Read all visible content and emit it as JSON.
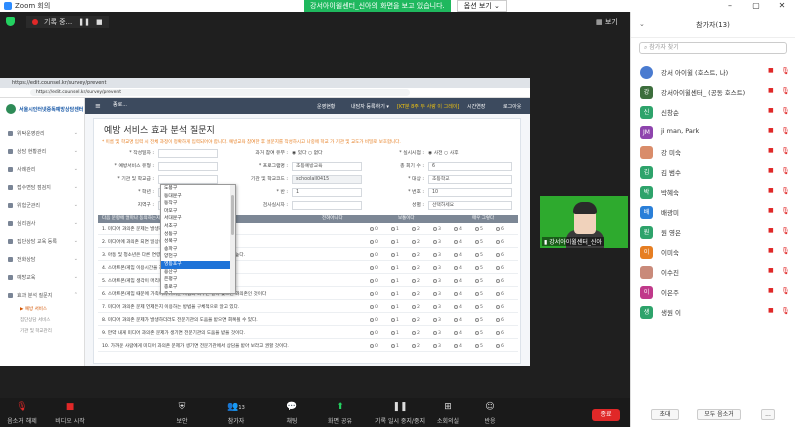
{
  "window": {
    "title": "Zoom 회의",
    "controls": [
      "–",
      "▢",
      "✕"
    ]
  },
  "share_banner": {
    "text": "강서아이윌센터_신아의 화면을 보고 있습니다.",
    "view_options": "옵션 보기 ⌄"
  },
  "recording": {
    "label": "기록 중...",
    "pause": "❚❚",
    "stop": "■"
  },
  "view_label": "보기",
  "browser": {
    "tab": "https://edit.counsel.kr/survey/prevent",
    "url": "https://edit.counsel.kr/survey/prevent"
  },
  "site": {
    "brand": "서울시인터넷중독예방상담센터",
    "nav": [
      {
        "label": "위탁운영관리"
      },
      {
        "label": "상담 현황관리"
      },
      {
        "label": "사례관리"
      },
      {
        "label": "접수면담 점검지"
      },
      {
        "label": "위험군관리"
      },
      {
        "label": "심리검사"
      },
      {
        "label": "집단상담 교육 등록"
      },
      {
        "label": "전화상담"
      },
      {
        "label": "예방교육"
      },
      {
        "label": "효과 분석 질문지"
      }
    ],
    "subnav": [
      {
        "label": "예방 서비스",
        "active": true
      },
      {
        "label": "집단상담 서비스",
        "active": false
      },
      {
        "label": "기관 및 학교관리",
        "active": false
      }
    ],
    "header": {
      "menu_icon": "≡",
      "combo": "종로...",
      "items": [
        "운영현황",
        "내담자 등록하기 ▾",
        "[KT분 8주 두 사랑 이 그레이]",
        "시간연장",
        "로그아웃"
      ]
    }
  },
  "form": {
    "title": "예방 서비스 효과 분석 질문지",
    "notice": "* 이름 및 학교명 입력 시 전체 과정이 정확하게 입력되어야 합니다. 예방교육 참여한 후 설문지를 작성하시고 나중에 학교 가 기관 및 교도가 비밀로 보호합니다.",
    "rows": [
      [
        {
          "label": "* 작성일자 :",
          "value": ""
        },
        {
          "label": "과거 참여 유무 :",
          "value": "◉ 있다   ○ 없다"
        },
        {
          "label": "* 실시시점 :",
          "value": "◉ 사전   ○ 사후"
        }
      ],
      [
        {
          "label": "* 예방서비스 유형 :",
          "value": ""
        },
        {
          "label": "* 프로그램명 :",
          "value": "초등예방교육"
        },
        {
          "label": "총 회기 수 :",
          "value": "6"
        }
      ],
      [
        {
          "label": "* 기관 및 학교급 :",
          "value": ""
        },
        {
          "label": "기관 및 학교코드 :",
          "value": "schoolall0415"
        },
        {
          "label": "* 대상 :",
          "value": "초등학교"
        }
      ],
      [
        {
          "label": "* 학년 :",
          "value": ""
        },
        {
          "label": "* 반 :",
          "value": "1"
        },
        {
          "label": "* 번호 :",
          "value": "10"
        }
      ],
      [
        {
          "label": "지역구 :",
          "value": "선택하세요"
        },
        {
          "label": "검사실시자 :",
          "value": ""
        },
        {
          "label": "성별 :",
          "value": "선택하세요"
        }
      ]
    ],
    "question_header": {
      "left": "다음 문항에 얼마나 동의하는지 체크해 주세요",
      "c1": "전혀아니다",
      "c2": "보통이다",
      "c3": "매우 그렇다"
    },
    "question_options": [
      "0",
      "1",
      "2",
      "3",
      "4",
      "5",
      "6"
    ],
    "questions": [
      "1. 미디어 과의존 문제는 발생하지 않도록 예방하는 것이 최선이다.",
      "2. 미디어에 과의존 되면 일상생활에 심각한 피해가 발생한다.",
      "3. 아동 및 청소년은 다른 연령대에 비해 미디어에 과의존될 위험성이 높다.",
      "4. 스마트폰/게임 이용시간을 지키는 것이 어려우면 과의존인 것이다.",
      "5. 스마트폰/게임 생각이 머리에서 떠나지 않으면 과의존인 것이다",
      "6. 스마트폰/게임 때문에 가족이나 가까운 사람과 다투는 일이 잦으면 과의존인 것이다",
      "7. 미디어 과의존 문제 언제든지 이용하는 방법을 구체적으로 알고 있다.",
      "8. 미디어 과의존 문제가 발생하더라도 전문기관의 도움을 받으면 회복될 수 있다.",
      "9. 만약 내게 미디어 과의존 문제가 생기면 전문기관의 도움을 받을 것이다.",
      "10. 가까운 사람에게 미디어 과의존 문제가 생기면 전문기관에서 상담을 받아 보라고 권할 것이다."
    ],
    "district_dropdown": {
      "options": [
        "도봉구",
        "동대문구",
        "동작구",
        "마포구",
        "서대문구",
        "서초구",
        "성동구",
        "성북구",
        "송파구",
        "양천구",
        "영등포구",
        "용산구",
        "은평구",
        "종로구",
        "중구",
        "중랑구"
      ],
      "selected": "영등포구"
    }
  },
  "self_video": {
    "caption": "강서아이윌센터_신아"
  },
  "toolbar": [
    {
      "label": "음소거 해제",
      "icon": "🎙"
    },
    {
      "label": "비디오 시작",
      "icon": "■"
    },
    {
      "label": "보안",
      "icon": "⛨"
    },
    {
      "label": "참가자",
      "icon": "👥",
      "count": "13"
    },
    {
      "label": "채팅",
      "icon": "💬"
    },
    {
      "label": "화면 공유",
      "icon": "⬆"
    },
    {
      "label": "기록 일시 중지/중지",
      "icon": "❚❚"
    },
    {
      "label": "소회의실",
      "icon": "⊞"
    },
    {
      "label": "반응",
      "icon": "☺"
    }
  ],
  "end_button": "종료",
  "participants": {
    "title": "참가자(13)",
    "search_placeholder": "참가자 찾기",
    "items": [
      {
        "name": "강서 아이윌 (호스트, 나)",
        "avatar": "",
        "color": "#4a7bd0"
      },
      {
        "name": "강서아이윌센터_ (공동 호스트)",
        "avatar": "강",
        "color": "#3d6e3d"
      },
      {
        "name": "신창순",
        "avatar": "신",
        "color": "#2ea36b"
      },
      {
        "name": "ji man, Park",
        "avatar": "JM",
        "color": "#8e44ad"
      },
      {
        "name": "강 미숙",
        "avatar": "",
        "color": "#d98c6a"
      },
      {
        "name": "김 범수",
        "avatar": "김",
        "color": "#2ea36b"
      },
      {
        "name": "박혜숙",
        "avatar": "박",
        "color": "#2ea36b"
      },
      {
        "name": "배광미",
        "avatar": "배",
        "color": "#2a7fd8"
      },
      {
        "name": "원 영은",
        "avatar": "원",
        "color": "#2ea36b"
      },
      {
        "name": "이미숙",
        "avatar": "이",
        "color": "#e67e22"
      },
      {
        "name": "이수진",
        "avatar": "",
        "color": "#c98a7a"
      },
      {
        "name": "이은주",
        "avatar": "이",
        "color": "#c0398a"
      },
      {
        "name": "생원 이",
        "avatar": "생",
        "color": "#2ea36b"
      }
    ],
    "footer": [
      "초대",
      "모두 음소거",
      "..."
    ]
  }
}
